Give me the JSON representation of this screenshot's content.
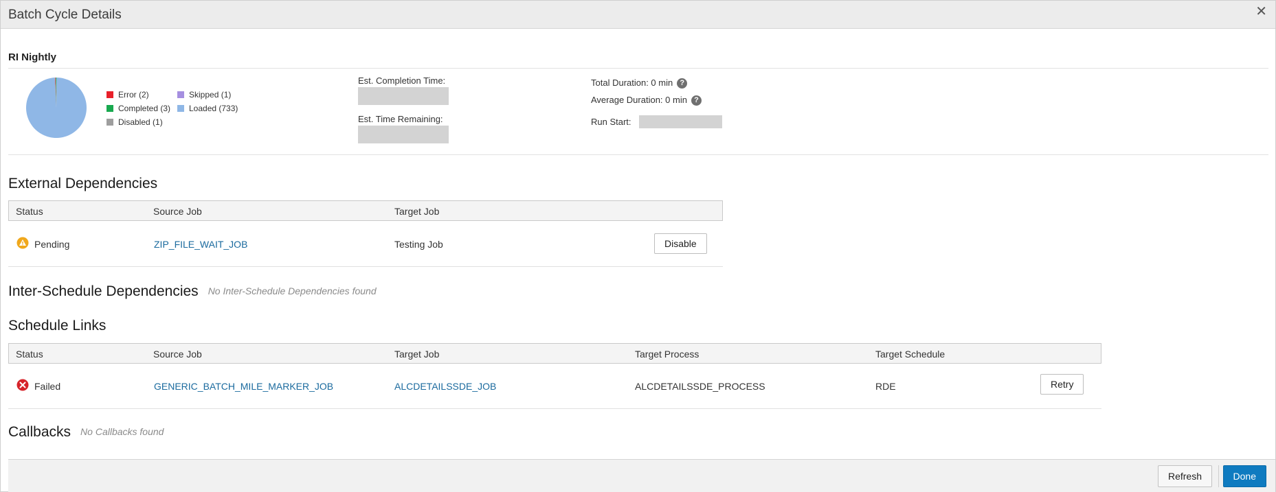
{
  "window": {
    "title": "Batch Cycle Details"
  },
  "summary": {
    "schedule_name": "RI Nightly",
    "legend": [
      {
        "label": "Error (2)",
        "color": "#e8202a"
      },
      {
        "label": "Skipped (1)",
        "color": "#a58fe0"
      },
      {
        "label": "Completed (3)",
        "color": "#18a94f"
      },
      {
        "label": "Loaded (733)",
        "color": "#8fb7e6"
      },
      {
        "label": "Disabled (1)",
        "color": "#9e9e9e"
      }
    ],
    "est_completion_label": "Est. Completion Time:",
    "est_remaining_label": "Est. Time Remaining:",
    "total_duration_label": "Total Duration: 0 min",
    "average_duration_label": "Average Duration: 0 min",
    "run_start_label": "Run Start:"
  },
  "chart_data": {
    "type": "pie",
    "categories": [
      "Error",
      "Skipped",
      "Completed",
      "Loaded",
      "Disabled"
    ],
    "values": [
      2,
      1,
      3,
      733,
      1
    ],
    "colors": [
      "#e8202a",
      "#a58fe0",
      "#18a94f",
      "#8fb7e6",
      "#9e9e9e"
    ],
    "legend": "right"
  },
  "external_dependencies": {
    "title": "External Dependencies",
    "columns": [
      "Status",
      "Source Job",
      "Target Job"
    ],
    "rows": [
      {
        "status": "Pending",
        "source_job": "ZIP_FILE_WAIT_JOB",
        "target_job": "Testing Job",
        "action": "Disable"
      }
    ]
  },
  "inter_schedule": {
    "title": "Inter-Schedule Dependencies",
    "empty_message": "No Inter-Schedule Dependencies found"
  },
  "schedule_links": {
    "title": "Schedule Links",
    "columns": [
      "Status",
      "Source Job",
      "Target Job",
      "Target Process",
      "Target Schedule"
    ],
    "rows": [
      {
        "status": "Failed",
        "source_job": "GENERIC_BATCH_MILE_MARKER_JOB",
        "target_job": "ALCDETAILSSDE_JOB",
        "target_process": "ALCDETAILSSDE_PROCESS",
        "target_schedule": "RDE",
        "action": "Retry"
      }
    ]
  },
  "callbacks": {
    "title": "Callbacks",
    "empty_message": "No Callbacks found"
  },
  "footer": {
    "refresh_label": "Refresh",
    "done_label": "Done"
  },
  "icons": {
    "close": "close-icon",
    "help": "help-icon",
    "warning": "warning-icon",
    "error": "error-icon"
  }
}
